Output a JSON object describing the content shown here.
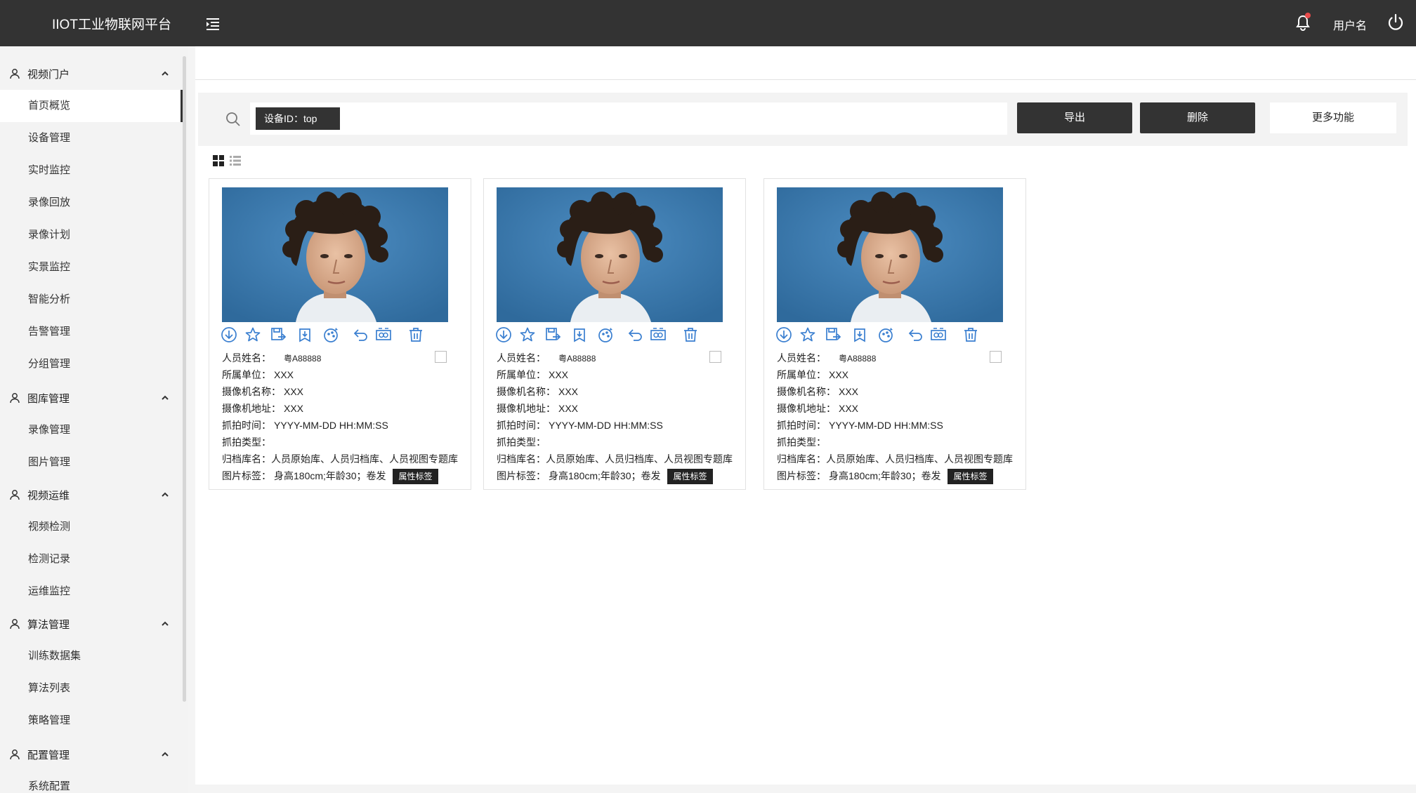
{
  "app": {
    "title": "IIOT工业物联网平台",
    "username": "用户名"
  },
  "sidebar": {
    "groups": [
      {
        "label": "视频门户",
        "items": [
          "首页概览",
          "设备管理",
          "实时监控",
          "录像回放",
          "录像计划",
          "实景监控",
          "智能分析",
          "告警管理",
          "分组管理"
        ]
      },
      {
        "label": "图库管理",
        "items": [
          "录像管理",
          "图片管理"
        ]
      },
      {
        "label": "视频运维",
        "items": [
          "视频检测",
          "检测记录",
          "运维监控"
        ]
      },
      {
        "label": "算法管理",
        "items": [
          "训练数据集",
          "算法列表",
          "策略管理"
        ]
      },
      {
        "label": "配置管理",
        "items": [
          "系统配置"
        ]
      }
    ],
    "active_item": "首页概览"
  },
  "toolbar": {
    "search_tag": "设备ID：top",
    "export_label": "导出",
    "delete_label": "删除",
    "more_label": "更多功能"
  },
  "cards": [
    {
      "person_name_label": "人员姓名：",
      "person_name": "粤A88888",
      "unit_label": "所属单位：",
      "unit": "XXX",
      "camera_name_label": "摄像机名称：",
      "camera_name": "XXX",
      "camera_addr_label": "摄像机地址：",
      "camera_addr": "XXX",
      "capture_time_label": "抓拍时间：",
      "capture_time": "YYYY-MM-DD HH:MM:SS",
      "capture_type_label": "抓拍类型：",
      "capture_type": "",
      "archive_label": "归档库名：",
      "archive": "人员原始库、人员归档库、人员视图专题库",
      "tags_label": "图片标签：",
      "tags": "身高180cm;年龄30；卷发",
      "attr_button": "属性标签"
    },
    {
      "person_name_label": "人员姓名：",
      "person_name": "粤A88888",
      "unit_label": "所属单位：",
      "unit": "XXX",
      "camera_name_label": "摄像机名称：",
      "camera_name": "XXX",
      "camera_addr_label": "摄像机地址：",
      "camera_addr": "XXX",
      "capture_time_label": "抓拍时间：",
      "capture_time": "YYYY-MM-DD HH:MM:SS",
      "capture_type_label": "抓拍类型：",
      "capture_type": "",
      "archive_label": "归档库名：",
      "archive": "人员原始库、人员归档库、人员视图专题库",
      "tags_label": "图片标签：",
      "tags": "身高180cm;年龄30；卷发",
      "attr_button": "属性标签"
    },
    {
      "person_name_label": "人员姓名：",
      "person_name": "粤A88888",
      "unit_label": "所属单位：",
      "unit": "XXX",
      "camera_name_label": "摄像机名称：",
      "camera_name": "XXX",
      "camera_addr_label": "摄像机地址：",
      "camera_addr": "XXX",
      "capture_time_label": "抓拍时间：",
      "capture_time": "YYYY-MM-DD HH:MM:SS",
      "capture_type_label": "抓拍类型：",
      "capture_type": "",
      "archive_label": "归档库名：",
      "archive": "人员原始库、人员归档库、人员视图专题库",
      "tags_label": "图片标签：",
      "tags": "身高180cm;年龄30；卷发",
      "attr_button": "属性标签"
    }
  ],
  "card_actions": [
    "download-icon",
    "star-icon",
    "save-icon",
    "bookmark-icon",
    "color-palette-icon",
    "undo-icon",
    "compare-icon",
    "trash-icon"
  ],
  "colors": {
    "topbar": "#333333",
    "accent_icon": "#3a7fd0",
    "notify_dot": "#e84b4b",
    "photo_bg": "#3c7fb4"
  }
}
